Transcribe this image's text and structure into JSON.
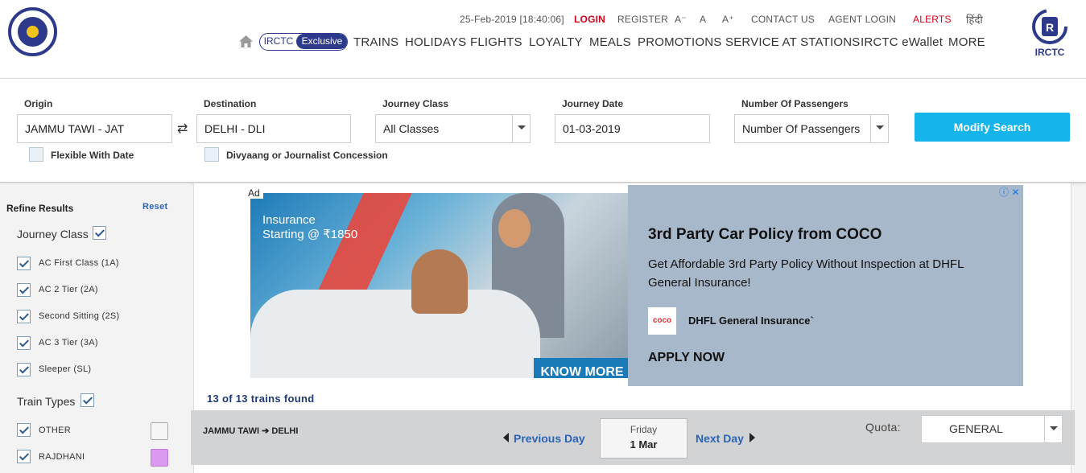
{
  "header": {
    "datetime": "25-Feb-2019 [18:40:06]",
    "login": "LOGIN",
    "register": "REGISTER",
    "font_small": "A⁻",
    "font_normal": "A",
    "font_large": "A⁺",
    "contact": "CONTACT US",
    "agent_login": "AGENT LOGIN",
    "alerts": "ALERTS",
    "hindi": "हिंदी",
    "exclusive_left": "IRCTC",
    "exclusive_right": "Exclusive",
    "nav": [
      "TRAINS",
      "HOLIDAYS",
      "FLIGHTS",
      "LOYALTY",
      "MEALS",
      "PROMOTIONS",
      "SERVICE AT STATIONS",
      "IRCTC eWallet",
      "MORE"
    ],
    "logo_text": "IRCTC"
  },
  "search": {
    "origin_label": "Origin",
    "origin_value": "JAMMU TAWI - JAT",
    "swap_icon": "⇄",
    "destination_label": "Destination",
    "destination_value": "DELHI - DLI",
    "class_label": "Journey Class",
    "class_value": "All Classes",
    "date_label": "Journey Date",
    "date_value": "01-03-2019",
    "passengers_label": "Number Of Passengers",
    "passengers_value": "Number Of Passengers",
    "flexible_label": "Flexible With Date",
    "divyaang_label": "Divyaang or Journalist Concession",
    "modify_button": "Modify Search",
    "accent_color": "#15b4ea"
  },
  "sidebar": {
    "title": "Refine Results",
    "reset": "Reset",
    "journey_class_title": "Journey Class",
    "classes": [
      "AC First Class (1A)",
      "AC 2 Tier (2A)",
      "Second Sitting (2S)",
      "AC 3 Tier (3A)",
      "Sleeper (SL)"
    ],
    "train_types_title": "Train Types",
    "train_types": [
      {
        "label": "OTHER",
        "color": "#f5f5f5"
      },
      {
        "label": "RAJDHANI",
        "color": "#d99af0"
      }
    ]
  },
  "ad": {
    "tag": "Ad",
    "photo_text": "Insurance\nStarting @ ₹1850",
    "know_more": "KNOW MORE",
    "title": "3rd Party Car Policy from COCO",
    "description": "Get Affordable 3rd Party Policy Without Inspection at DHFL General Insurance!",
    "brand_logo": "coco",
    "brand": "DHFL General Insurance`",
    "apply": "APPLY NOW",
    "icons": "ⓘ ✕"
  },
  "results": {
    "found": "13 of 13 trains found",
    "route": "JAMMU TAWI ➔ DELHI",
    "prev_day": "Previous Day",
    "next_day": "Next Day",
    "day_name": "Friday",
    "day_date": "1 Mar",
    "quota_label": "Quota:",
    "quota_value": "GENERAL"
  }
}
